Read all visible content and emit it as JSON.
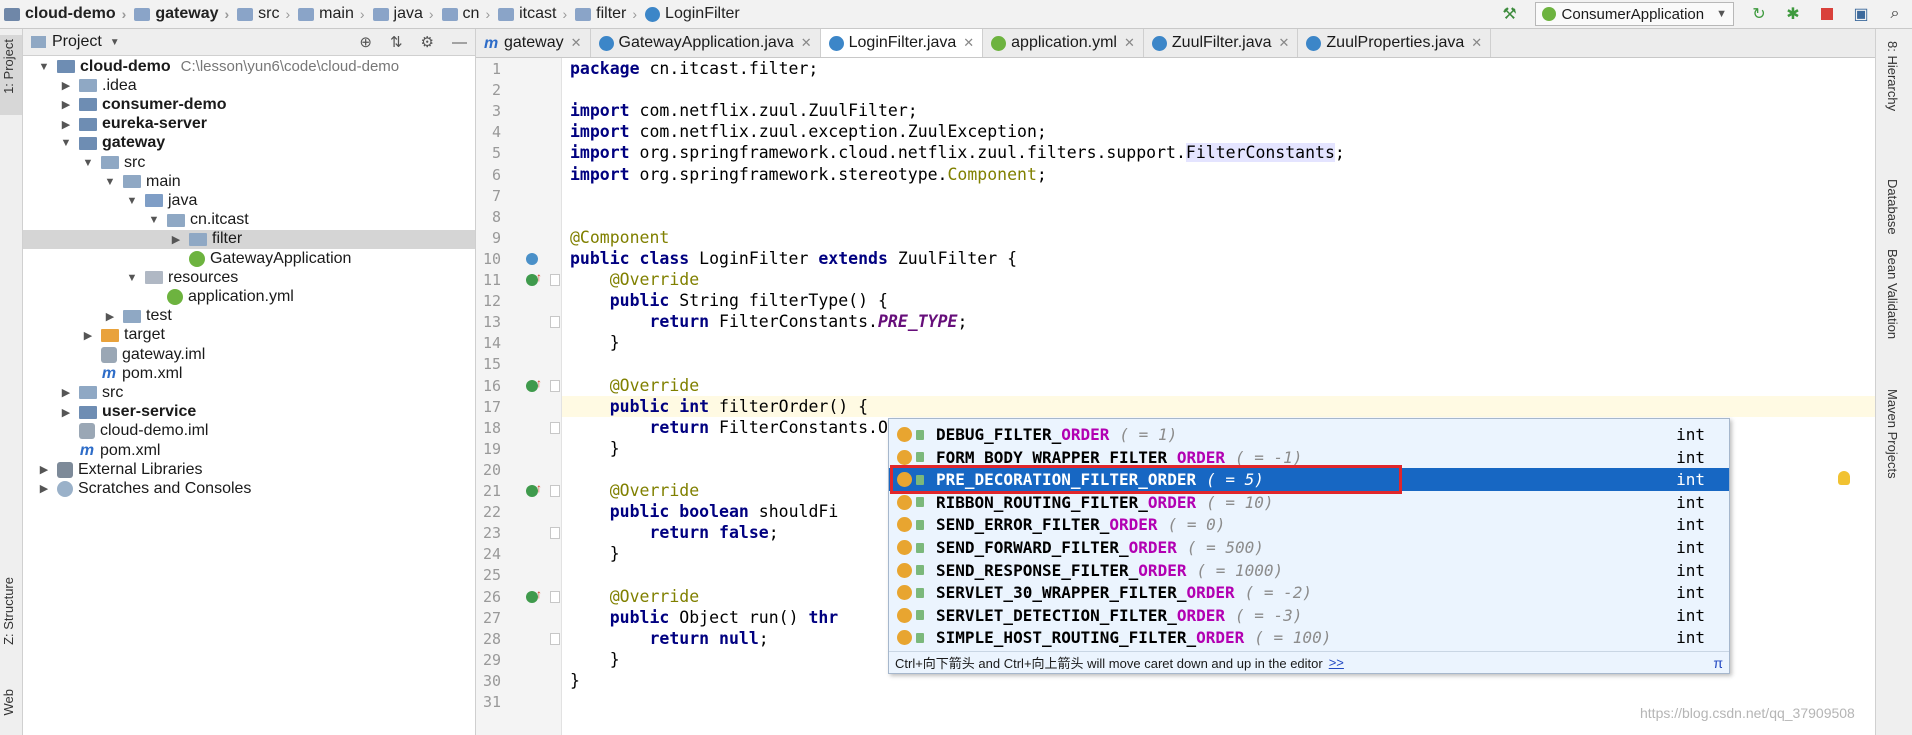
{
  "breadcrumbs": [
    {
      "label": "cloud-demo",
      "icon": "project-icon",
      "bold": true
    },
    {
      "label": "gateway",
      "icon": "module-folder-icon",
      "bold": true
    },
    {
      "label": "src",
      "icon": "folder-icon",
      "bold": false
    },
    {
      "label": "main",
      "icon": "folder-icon",
      "bold": false
    },
    {
      "label": "java",
      "icon": "source-folder-icon",
      "bold": false
    },
    {
      "label": "cn",
      "icon": "package-icon",
      "bold": false
    },
    {
      "label": "itcast",
      "icon": "package-icon",
      "bold": false
    },
    {
      "label": "filter",
      "icon": "package-icon",
      "bold": false
    },
    {
      "label": "LoginFilter",
      "icon": "class-icon",
      "bold": false
    }
  ],
  "toolbar": {
    "run_config": "ConsumerApplication",
    "icons": [
      "hammer-icon",
      "reload-icon",
      "debug-icon",
      "stop-icon",
      "layout-icon",
      "search-icon"
    ]
  },
  "left_stripe": {
    "project_tab": "1: Project",
    "structure_tab": "Z: Structure",
    "web_tab": "Web"
  },
  "right_stripe": {
    "hierarchy": "8: Hierarchy",
    "database": "Database",
    "bean_validation": "Bean Validation",
    "maven": "Maven Projects"
  },
  "project_panel": {
    "title": "Project",
    "tree": [
      {
        "label": "cloud-demo",
        "path": "C:\\lesson\\yun6\\code\\cloud-demo",
        "depth": 0,
        "arrow": "down",
        "icon": "module",
        "bold": true
      },
      {
        "label": ".idea",
        "depth": 1,
        "arrow": "right",
        "icon": "folder",
        "bold": false
      },
      {
        "label": "consumer-demo",
        "depth": 1,
        "arrow": "right",
        "icon": "module",
        "bold": true
      },
      {
        "label": "eureka-server",
        "depth": 1,
        "arrow": "right",
        "icon": "module",
        "bold": true
      },
      {
        "label": "gateway",
        "depth": 1,
        "arrow": "down",
        "icon": "module",
        "bold": true
      },
      {
        "label": "src",
        "depth": 2,
        "arrow": "down",
        "icon": "folder",
        "bold": false
      },
      {
        "label": "main",
        "depth": 3,
        "arrow": "down",
        "icon": "folder",
        "bold": false
      },
      {
        "label": "java",
        "depth": 4,
        "arrow": "down",
        "icon": "src",
        "bold": false
      },
      {
        "label": "cn.itcast",
        "depth": 5,
        "arrow": "down",
        "icon": "folder",
        "bold": false
      },
      {
        "label": "filter",
        "depth": 6,
        "arrow": "right",
        "icon": "folder",
        "bold": false,
        "selected": true
      },
      {
        "label": "GatewayApplication",
        "depth": 6,
        "arrow": "",
        "icon": "spring",
        "bold": false
      },
      {
        "label": "resources",
        "depth": 4,
        "arrow": "down",
        "icon": "res",
        "bold": false
      },
      {
        "label": "application.yml",
        "depth": 5,
        "arrow": "",
        "icon": "spring",
        "bold": false
      },
      {
        "label": "test",
        "depth": 3,
        "arrow": "right",
        "icon": "folder",
        "bold": false
      },
      {
        "label": "target",
        "depth": 2,
        "arrow": "right",
        "icon": "tgt",
        "bold": false
      },
      {
        "label": "gateway.iml",
        "depth": 2,
        "arrow": "",
        "icon": "iml",
        "bold": false
      },
      {
        "label": "pom.xml",
        "depth": 2,
        "arrow": "",
        "icon": "mvn",
        "bold": false
      },
      {
        "label": "src",
        "depth": 1,
        "arrow": "right",
        "icon": "folder",
        "bold": false
      },
      {
        "label": "user-service",
        "depth": 1,
        "arrow": "right",
        "icon": "module",
        "bold": true
      },
      {
        "label": "cloud-demo.iml",
        "depth": 1,
        "arrow": "",
        "icon": "iml",
        "bold": false
      },
      {
        "label": "pom.xml",
        "depth": 1,
        "arrow": "",
        "icon": "mvn",
        "bold": false
      },
      {
        "label": "External Libraries",
        "depth": 0,
        "arrow": "right",
        "icon": "lib",
        "bold": false
      },
      {
        "label": "Scratches and Consoles",
        "depth": 0,
        "arrow": "right",
        "icon": "scr",
        "bold": false
      }
    ]
  },
  "tabs": [
    {
      "label": "gateway",
      "icon": "maven-icon",
      "active": false
    },
    {
      "label": "GatewayApplication.java",
      "icon": "spring-class-icon",
      "active": false
    },
    {
      "label": "LoginFilter.java",
      "icon": "class-icon",
      "active": true
    },
    {
      "label": "application.yml",
      "icon": "spring-yml-icon",
      "active": false
    },
    {
      "label": "ZuulFilter.java",
      "icon": "class-icon",
      "active": false
    },
    {
      "label": "ZuulProperties.java",
      "icon": "class-icon",
      "active": false
    }
  ],
  "code_lines": [
    "package cn.itcast.filter;",
    "",
    "import com.netflix.zuul.ZuulFilter;",
    "import com.netflix.zuul.exception.ZuulException;",
    "import org.springframework.cloud.netflix.zuul.filters.support.FilterConstants;",
    "import org.springframework.stereotype.Component;",
    "",
    "",
    "@Component",
    "public class LoginFilter extends ZuulFilter {",
    "    @Override",
    "    public String filterType() {",
    "        return FilterConstants.PRE_TYPE;",
    "    }",
    "",
    "    @Override",
    "    public int filterOrder() {",
    "        return FilterConstants.ORDER;",
    "    }",
    "",
    "    @Override",
    "    public boolean shouldFi",
    "        return false;",
    "    }",
    "",
    "    @Override",
    "    public Object run() thr",
    "        return null;",
    "    }",
    "}",
    ""
  ],
  "completion": {
    "items": [
      {
        "prefix": "DEBUG_FILTER_",
        "match": "ORDER",
        "value": "( = 1)",
        "type": "int",
        "selected": false
      },
      {
        "prefix": "FORM_BODY_WRAPPER_FILTER_",
        "match": "ORDER",
        "value": "( = -1)",
        "type": "int",
        "selected": false
      },
      {
        "prefix": "PRE_DECORATION_FILTER_",
        "match": "ORDER",
        "value": "( = 5)",
        "type": "int",
        "selected": true
      },
      {
        "prefix": "RIBBON_ROUTING_FILTER_",
        "match": "ORDER",
        "value": "( = 10)",
        "type": "int",
        "selected": false
      },
      {
        "prefix": "SEND_ERROR_FILTER_",
        "match": "ORDER",
        "value": "( = 0)",
        "type": "int",
        "selected": false
      },
      {
        "prefix": "SEND_FORWARD_FILTER_",
        "match": "ORDER",
        "value": "( = 500)",
        "type": "int",
        "selected": false
      },
      {
        "prefix": "SEND_RESPONSE_FILTER_",
        "match": "ORDER",
        "value": "( = 1000)",
        "type": "int",
        "selected": false
      },
      {
        "prefix": "SERVLET_30_WRAPPER_FILTER_",
        "match": "ORDER",
        "value": "( = -2)",
        "type": "int",
        "selected": false
      },
      {
        "prefix": "SERVLET_DETECTION_FILTER_",
        "match": "ORDER",
        "value": "( = -3)",
        "type": "int",
        "selected": false
      },
      {
        "prefix": "SIMPLE_HOST_ROUTING_FILTER_",
        "match": "ORDER",
        "value": "( = 100)",
        "type": "int",
        "selected": false
      }
    ],
    "hint": "Ctrl+向下箭头 and Ctrl+向上箭头 will move caret down and up in the editor",
    "hint_link": ">>",
    "pi": "π"
  },
  "watermark": "https://blog.csdn.net/qq_37909508",
  "colors": {
    "keyword": "#000080",
    "annotation": "#808000",
    "constant": "#660e7a",
    "selection": "#1767c3",
    "highlight_box": "#e0262b"
  }
}
